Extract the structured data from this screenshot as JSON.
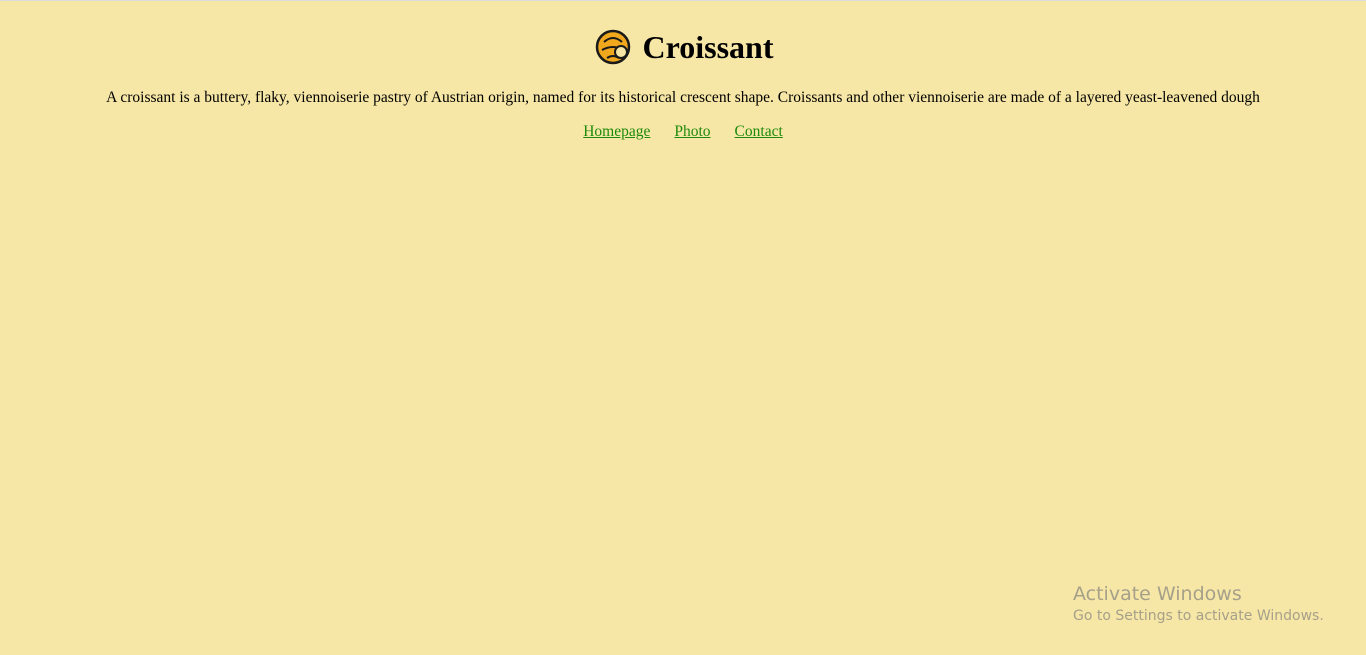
{
  "page": {
    "background_color": "#f7e7a6",
    "link_color": "#1e8a0c"
  },
  "header": {
    "logo_icon": "croissant-icon",
    "title": "Croissant"
  },
  "main": {
    "description": "A croissant is a buttery, flaky, viennoiserie pastry of Austrian origin, named for its historical crescent shape. Croissants and other viennoiserie are made of a layered yeast-leavened dough"
  },
  "nav": {
    "links": [
      {
        "label": "Homepage"
      },
      {
        "label": "Photo"
      },
      {
        "label": "Contact"
      }
    ]
  },
  "os_watermark": {
    "title": "Activate Windows",
    "subtitle": "Go to Settings to activate Windows."
  }
}
